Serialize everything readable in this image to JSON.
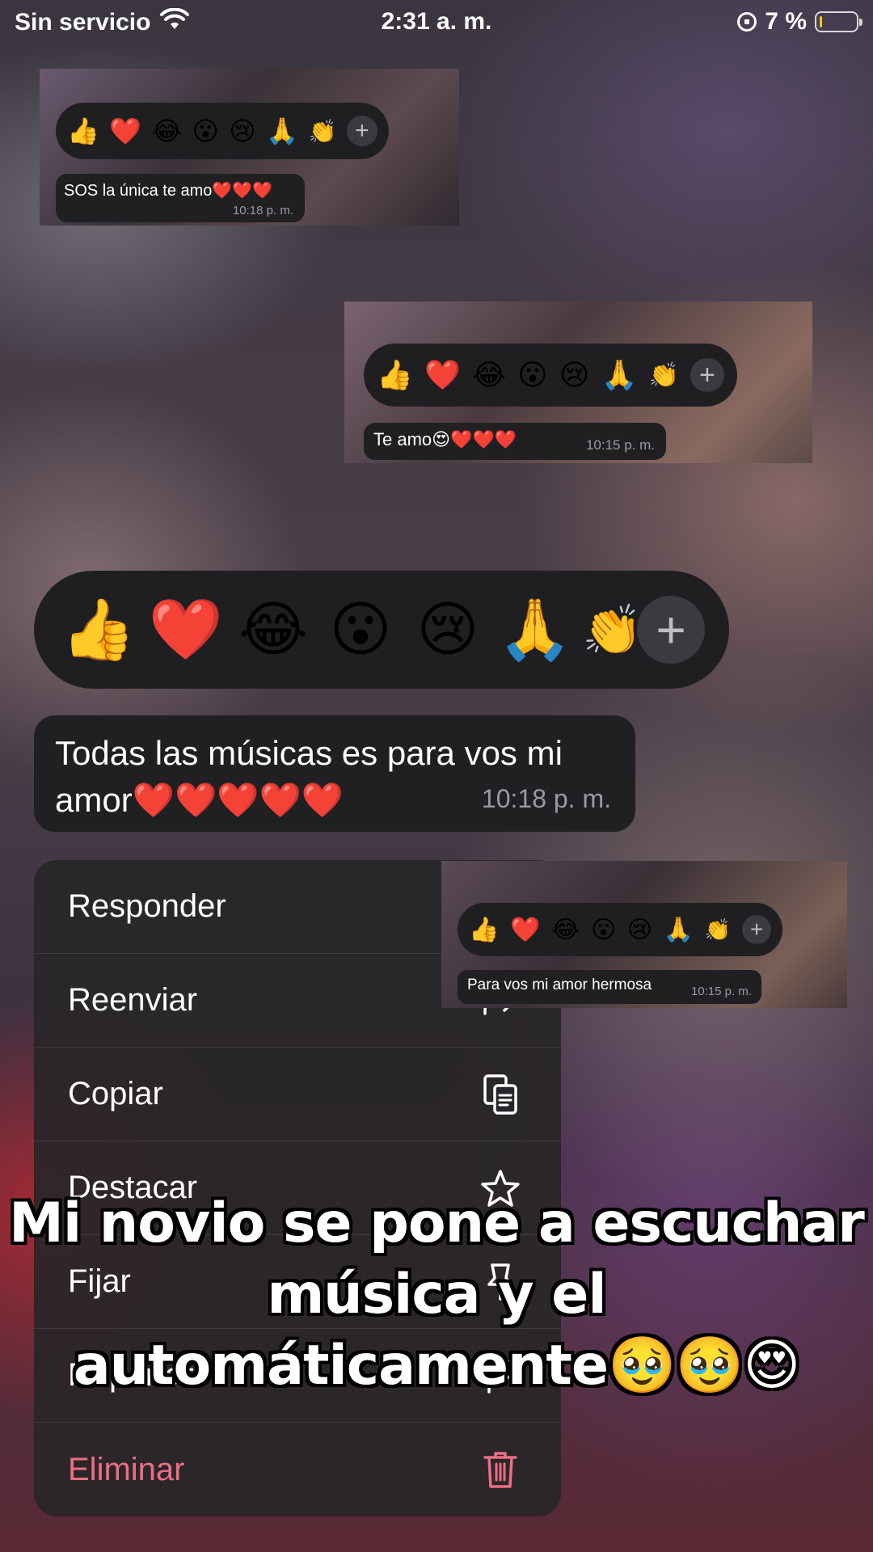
{
  "status_bar": {
    "carrier": "Sin servicio",
    "time": "2:31 a. m.",
    "battery_percent": "7 %",
    "battery_level": 0.07
  },
  "reactions": {
    "emojis": [
      "👍",
      "❤️",
      "😂",
      "😮",
      "😢",
      "🙏",
      "👏"
    ],
    "more": "+"
  },
  "thumbnails": [
    {
      "message": "SOS la única te amo❤️❤️❤️",
      "time": "10:18 p. m."
    },
    {
      "message": "Te amo😍❤️❤️❤️",
      "time": "10:15 p. m."
    },
    {
      "message": "Para vos mi amor hermosa",
      "time": "10:15 p. m."
    }
  ],
  "main_message": {
    "text": "Todas las músicas es para vos mi amor❤️❤️❤️❤️❤️",
    "time": "10:18 p. m."
  },
  "context_menu": {
    "items": [
      {
        "label": "Responder",
        "icon": "reply-icon"
      },
      {
        "label": "Reenviar",
        "icon": "forward-icon"
      },
      {
        "label": "Copiar",
        "icon": "copy-icon"
      },
      {
        "label": "Destacar",
        "icon": "star-icon"
      },
      {
        "label": "Fijar",
        "icon": "pin-icon"
      },
      {
        "label": "Reportar",
        "icon": "report-icon"
      },
      {
        "label": "Eliminar",
        "icon": "trash-icon"
      }
    ]
  },
  "caption": {
    "text": "Mi novio se pone a escuchar música y el automáticamente🥹🥹😍"
  },
  "colors": {
    "bubble": "#202022",
    "danger": "#ea6f84",
    "battery_fill": "#f5c518"
  }
}
